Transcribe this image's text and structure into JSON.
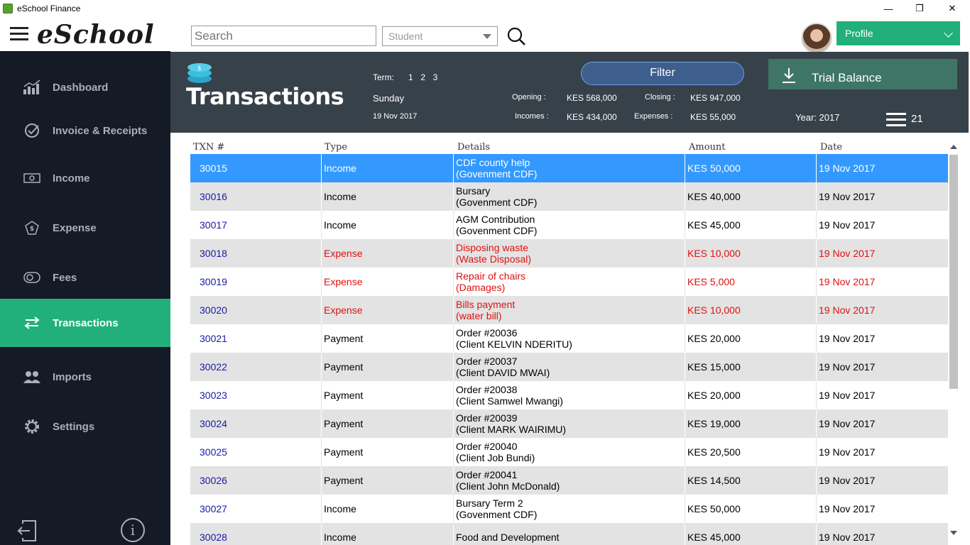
{
  "window": {
    "title": "eSchool Finance",
    "minimize": "—",
    "maximize": "❐",
    "close": "✕"
  },
  "topbar": {
    "logo": "eSchool",
    "search_placeholder": "Search",
    "student_select": "Student",
    "profile_label": "Profile"
  },
  "sidebar": {
    "items": [
      {
        "label": "Dashboard",
        "icon": "chart-icon"
      },
      {
        "label": "Invoice & Receipts",
        "icon": "check-circle-icon"
      },
      {
        "label": "Income",
        "icon": "money-icon"
      },
      {
        "label": "Expense",
        "icon": "expense-icon"
      },
      {
        "label": "Fees",
        "icon": "coins-icon"
      },
      {
        "label": "Transactions",
        "icon": "swap-icon",
        "active": true
      },
      {
        "label": "Imports",
        "icon": "users-icon"
      },
      {
        "label": "Settings",
        "icon": "gear-icon"
      }
    ],
    "info_label": "i"
  },
  "header": {
    "title": "Transactions",
    "term_label": "Term:",
    "terms": "1  2  3",
    "day": "Sunday",
    "date": "19 Nov 2017",
    "opening_label": "Opening :",
    "opening_value": "KES 568,000",
    "closing_label": "Closing :",
    "closing_value": "KES 947,000",
    "incomes_label": "Incomes :",
    "incomes_value": "KES 434,000",
    "expenses_label": "Expenses :",
    "expenses_value": "KES 55,000",
    "year": "Year: 2017",
    "count": "21",
    "filter_label": "Filter",
    "trial_label": "Trial Balance"
  },
  "table": {
    "columns": [
      "TXN #",
      "Type",
      "Details",
      "Amount",
      "Date"
    ],
    "rows": [
      {
        "txn": "30015",
        "type": "Income",
        "d1": "CDF county help",
        "d2": "(Govenment CDF)",
        "amount": "KES 50,000",
        "date": "19 Nov 2017",
        "kind": "sel"
      },
      {
        "txn": "30016",
        "type": "Income",
        "d1": "Bursary",
        "d2": "(Govenment CDF)",
        "amount": "KES 40,000",
        "date": "19 Nov 2017",
        "kind": "alt"
      },
      {
        "txn": "30017",
        "type": "Income",
        "d1": "AGM Contribution",
        "d2": "(Govenment CDF)",
        "amount": "KES 45,000",
        "date": "19 Nov 2017",
        "kind": "plain"
      },
      {
        "txn": "30018",
        "type": "Expense",
        "d1": "Disposing waste",
        "d2": "(Waste Disposal)",
        "amount": "KES 10,000",
        "date": "19 Nov 2017",
        "kind": "alt expense"
      },
      {
        "txn": "30019",
        "type": "Expense",
        "d1": "Repair of chairs",
        "d2": "(Damages)",
        "amount": "KES 5,000",
        "date": "19 Nov 2017",
        "kind": "plain expense"
      },
      {
        "txn": "30020",
        "type": "Expense",
        "d1": "Bills payment",
        "d2": "(water bill)",
        "amount": "KES 10,000",
        "date": "19 Nov 2017",
        "kind": "alt expense"
      },
      {
        "txn": "30021",
        "type": "Payment",
        "d1": "Order #20036",
        "d2": "(Client KELVIN NDERITU)",
        "amount": "KES 20,000",
        "date": "19 Nov 2017",
        "kind": "plain"
      },
      {
        "txn": "30022",
        "type": "Payment",
        "d1": "Order #20037",
        "d2": "(Client DAVID MWAI)",
        "amount": "KES 15,000",
        "date": "19 Nov 2017",
        "kind": "alt"
      },
      {
        "txn": "30023",
        "type": "Payment",
        "d1": "Order #20038",
        "d2": "(Client Samwel  Mwangi)",
        "amount": "KES 20,000",
        "date": "19 Nov 2017",
        "kind": "plain"
      },
      {
        "txn": "30024",
        "type": "Payment",
        "d1": "Order #20039",
        "d2": "(Client MARK WAIRIMU)",
        "amount": "KES 19,000",
        "date": "19 Nov 2017",
        "kind": "alt"
      },
      {
        "txn": "30025",
        "type": "Payment",
        "d1": "Order #20040",
        "d2": "(Client Job  Bundi)",
        "amount": "KES 20,500",
        "date": "19 Nov 2017",
        "kind": "plain"
      },
      {
        "txn": "30026",
        "type": "Payment",
        "d1": "Order #20041",
        "d2": "(Client John McDonald)",
        "amount": "KES 14,500",
        "date": "19 Nov 2017",
        "kind": "alt"
      },
      {
        "txn": "30027",
        "type": "Income",
        "d1": "Bursary Term 2",
        "d2": "(Govenment CDF)",
        "amount": "KES 50,000",
        "date": "19 Nov 2017",
        "kind": "plain"
      },
      {
        "txn": "30028",
        "type": "Income",
        "d1": "Food and Development",
        "d2": "",
        "amount": "KES 45,000",
        "date": "19 Nov 2017",
        "kind": "alt"
      }
    ]
  },
  "colors": {
    "accent": "#21b07b",
    "sidebar": "#151b26",
    "header": "#37414a",
    "selected": "#3399ff",
    "expense": "#e01010",
    "link": "#1a1aa6"
  }
}
